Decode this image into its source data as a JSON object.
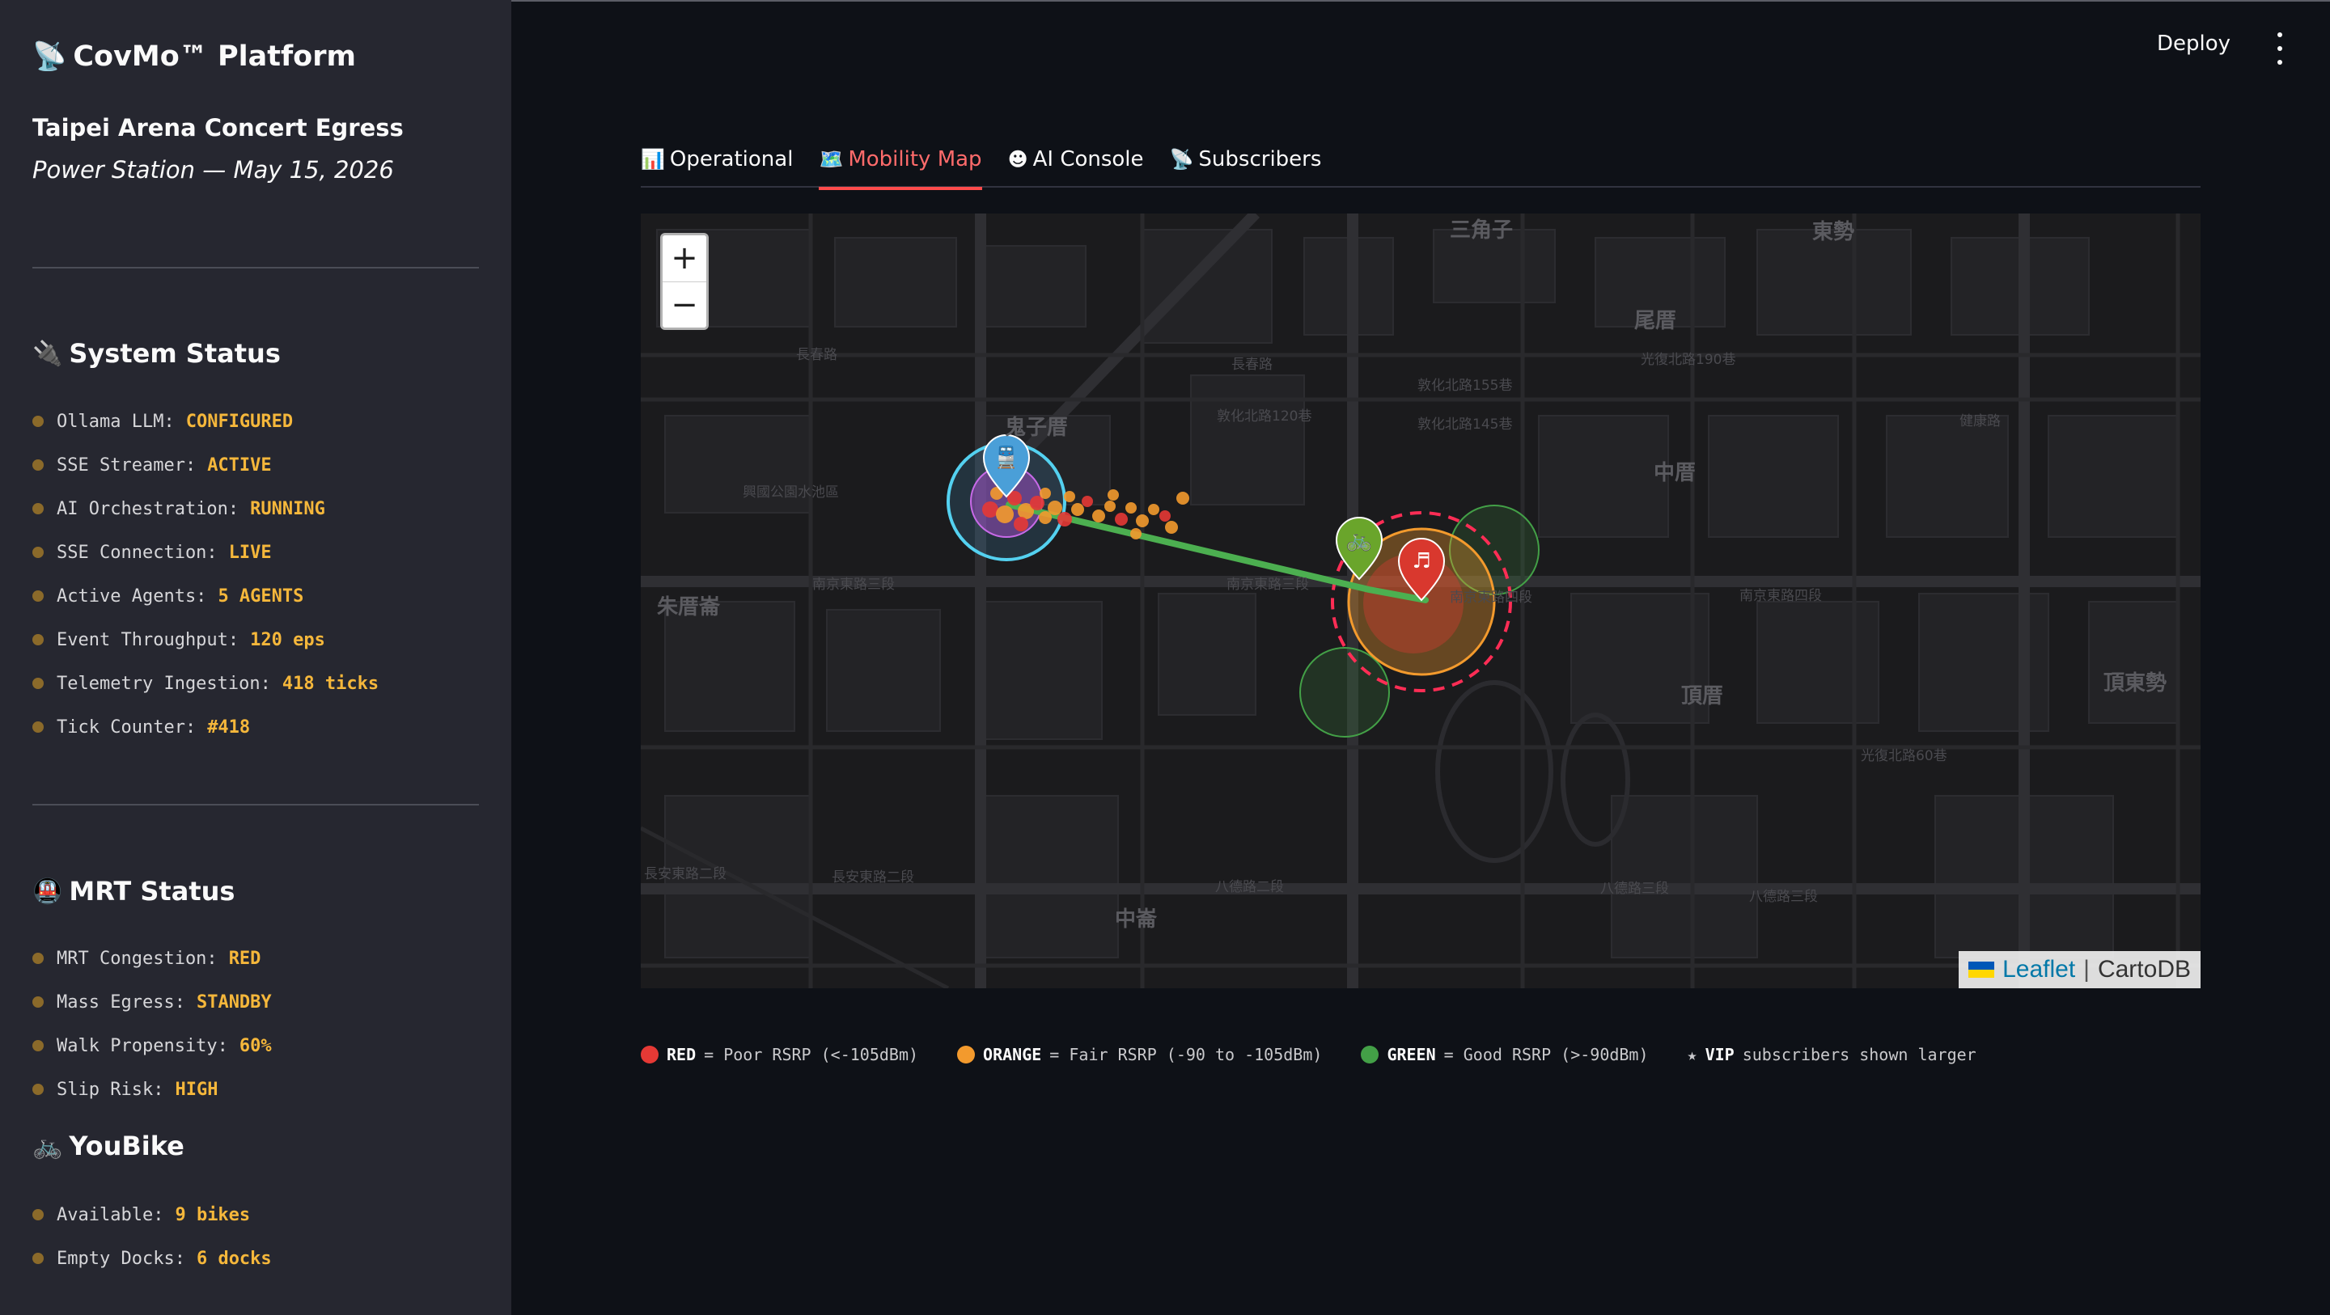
{
  "sidebar": {
    "brand_icon": "📡",
    "brand": "CovMo™ Platform",
    "event_title_main": "Taipei Arena Concert Egress",
    "event_title_em": "Power Station — May 15, 2026",
    "system_status": {
      "icon": "🔌",
      "title": "System Status",
      "items": [
        {
          "label": "Ollama LLM:",
          "value": "CONFIGURED"
        },
        {
          "label": "SSE Streamer:",
          "value": "ACTIVE"
        },
        {
          "label": "AI Orchestration:",
          "value": "RUNNING"
        },
        {
          "label": "SSE Connection:",
          "value": "LIVE"
        },
        {
          "label": "Active Agents:",
          "value": "5 AGENTS"
        },
        {
          "label": "Event Throughput:",
          "value": "120 eps"
        },
        {
          "label": "Telemetry Ingestion:",
          "value": "418 ticks"
        },
        {
          "label": "Tick Counter:",
          "value": "#418"
        }
      ]
    },
    "mrt_status": {
      "icon": "🚇",
      "title": "MRT Status",
      "items": [
        {
          "label": "MRT Congestion:",
          "value": "RED"
        },
        {
          "label": "Mass Egress:",
          "value": "STANDBY"
        },
        {
          "label": "Walk Propensity:",
          "value": "60%"
        },
        {
          "label": "Slip Risk:",
          "value": "HIGH"
        }
      ]
    },
    "youbike": {
      "icon": "🚲",
      "title": "YouBike",
      "items": [
        {
          "label": "Available:",
          "value": "9 bikes"
        },
        {
          "label": "Empty Docks:",
          "value": "6 docks"
        }
      ]
    }
  },
  "header": {
    "deploy": "Deploy"
  },
  "tabs": [
    {
      "icon": "📊",
      "label": "Operational",
      "active": false
    },
    {
      "icon": "🗺️",
      "label": "Mobility Map",
      "active": true
    },
    {
      "icon": "☻",
      "label": "AI Console",
      "active": false
    },
    {
      "icon": "📡",
      "label": "Subscribers",
      "active": false
    }
  ],
  "map": {
    "zoom_in": "+",
    "zoom_out": "−",
    "attribution_leaflet": "Leaflet",
    "attribution_sep": "|",
    "attribution_tiles": "CartoDB",
    "district_labels": [
      "三角子",
      "東勢",
      "尾厝",
      "鬼子厝",
      "中厝",
      "朱厝崙",
      "頂厝",
      "頂東勢",
      "中崙"
    ],
    "road_labels": [
      "南京東路三段",
      "南京東路三段",
      "南京東路四段",
      "南京東路四段",
      "長春路",
      "長春路",
      "八德路二段",
      "八德路三段",
      "八德路三段",
      "長安東路二段",
      "長安東路二段",
      "敦化北路120巷",
      "敦化北路145巷",
      "敦化北路155巷",
      "光復北路190巷",
      "健康路",
      "興國公園水池區",
      "光復北路60巷"
    ],
    "colors": {
      "red": "#e53935",
      "orange": "#f39a2d",
      "green": "#43a047",
      "route": "#4caf50",
      "station": "#4a9fd8",
      "venue": "#d9382e",
      "bike": "#6aa52b",
      "halo": "#54d1f0"
    },
    "icons": [
      "train-icon",
      "music-note-icon",
      "bicycle-icon"
    ]
  },
  "legend": [
    {
      "color": "#e53935",
      "bold": "RED",
      "text": "= Poor RSRP (<-105dBm)"
    },
    {
      "color": "#f39a2d",
      "bold": "ORANGE",
      "text": "= Fair RSRP (-90 to -105dBm)"
    },
    {
      "color": "#43a047",
      "bold": "GREEN",
      "text": "= Good RSRP (>-90dBm)"
    },
    {
      "color": "",
      "bold": "VIP",
      "text": "subscribers shown larger",
      "prefix": "★"
    }
  ]
}
